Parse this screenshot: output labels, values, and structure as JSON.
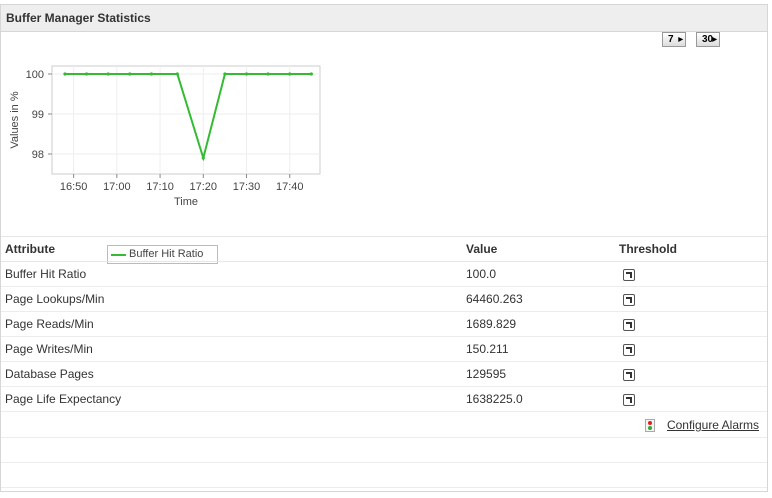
{
  "panel": {
    "title": "Buffer Manager Statistics"
  },
  "period_buttons": [
    {
      "label": "7"
    },
    {
      "label": "30"
    }
  ],
  "chart_data": {
    "type": "line",
    "xlabel": "Time",
    "ylabel": "Values in %",
    "x_ticks": [
      "16:50",
      "17:00",
      "17:10",
      "17:20",
      "17:30",
      "17:40"
    ],
    "y_ticks": [
      98,
      99,
      100
    ],
    "ylim": [
      97.5,
      100.2
    ],
    "grid": true,
    "legend": "bottom",
    "series": [
      {
        "name": "Buffer Hit Ratio",
        "color": "#33bb33",
        "x": [
          "16:48",
          "16:53",
          "16:58",
          "17:03",
          "17:08",
          "17:14",
          "17:20",
          "17:25",
          "17:30",
          "17:35",
          "17:40",
          "17:45"
        ],
        "values": [
          100,
          100,
          100,
          100,
          100,
          100,
          97.9,
          100,
          100,
          100,
          100,
          100
        ]
      }
    ]
  },
  "table": {
    "headers": {
      "attribute": "Attribute",
      "value": "Value",
      "threshold": "Threshold"
    },
    "rows": [
      {
        "attribute": "Buffer Hit Ratio",
        "value": "100.0"
      },
      {
        "attribute": "Page Lookups/Min",
        "value": "64460.263"
      },
      {
        "attribute": "Page Reads/Min",
        "value": "1689.829"
      },
      {
        "attribute": "Page Writes/Min",
        "value": "150.211"
      },
      {
        "attribute": "Database Pages",
        "value": "129595"
      },
      {
        "attribute": "Page Life Expectancy",
        "value": "1638225.0"
      }
    ]
  },
  "alarms": {
    "link_label": "Configure Alarms"
  }
}
